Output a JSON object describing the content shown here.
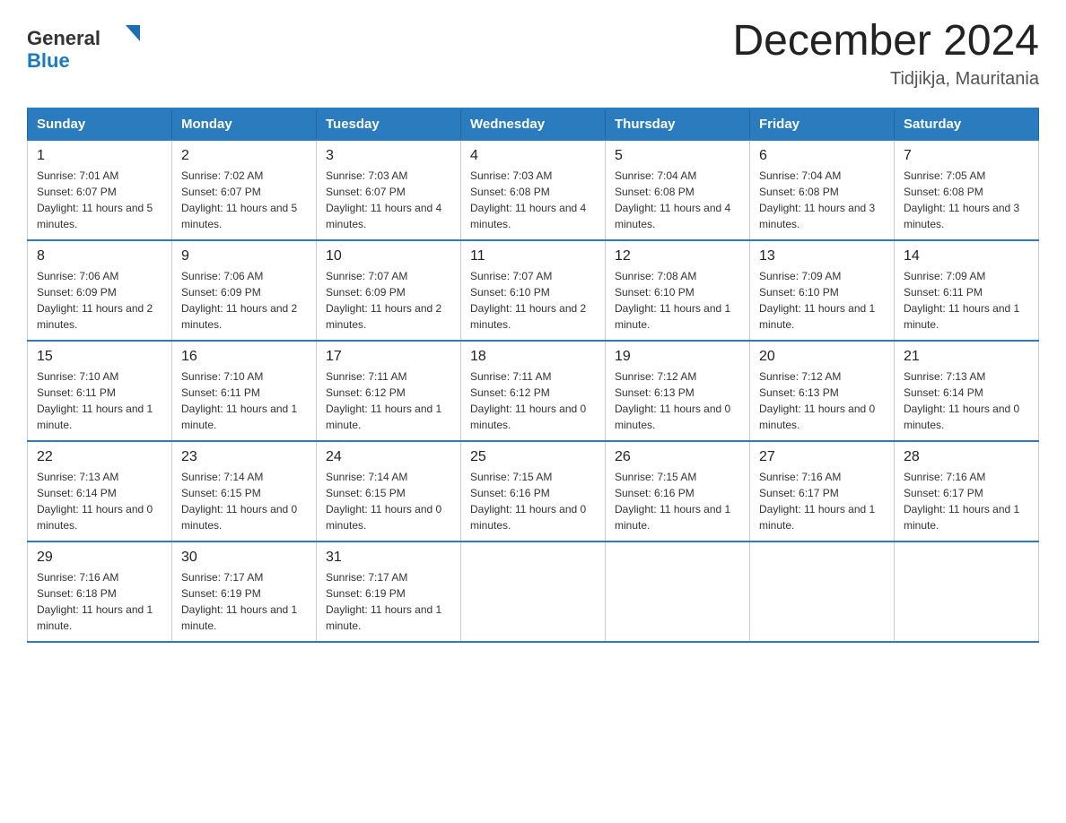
{
  "header": {
    "title": "December 2024",
    "subtitle": "Tidjikja, Mauritania",
    "logo_general": "General",
    "logo_blue": "Blue"
  },
  "calendar": {
    "days_of_week": [
      "Sunday",
      "Monday",
      "Tuesday",
      "Wednesday",
      "Thursday",
      "Friday",
      "Saturday"
    ],
    "weeks": [
      [
        {
          "day": "1",
          "sunrise": "7:01 AM",
          "sunset": "6:07 PM",
          "daylight": "11 hours and 5 minutes."
        },
        {
          "day": "2",
          "sunrise": "7:02 AM",
          "sunset": "6:07 PM",
          "daylight": "11 hours and 5 minutes."
        },
        {
          "day": "3",
          "sunrise": "7:03 AM",
          "sunset": "6:07 PM",
          "daylight": "11 hours and 4 minutes."
        },
        {
          "day": "4",
          "sunrise": "7:03 AM",
          "sunset": "6:08 PM",
          "daylight": "11 hours and 4 minutes."
        },
        {
          "day": "5",
          "sunrise": "7:04 AM",
          "sunset": "6:08 PM",
          "daylight": "11 hours and 4 minutes."
        },
        {
          "day": "6",
          "sunrise": "7:04 AM",
          "sunset": "6:08 PM",
          "daylight": "11 hours and 3 minutes."
        },
        {
          "day": "7",
          "sunrise": "7:05 AM",
          "sunset": "6:08 PM",
          "daylight": "11 hours and 3 minutes."
        }
      ],
      [
        {
          "day": "8",
          "sunrise": "7:06 AM",
          "sunset": "6:09 PM",
          "daylight": "11 hours and 2 minutes."
        },
        {
          "day": "9",
          "sunrise": "7:06 AM",
          "sunset": "6:09 PM",
          "daylight": "11 hours and 2 minutes."
        },
        {
          "day": "10",
          "sunrise": "7:07 AM",
          "sunset": "6:09 PM",
          "daylight": "11 hours and 2 minutes."
        },
        {
          "day": "11",
          "sunrise": "7:07 AM",
          "sunset": "6:10 PM",
          "daylight": "11 hours and 2 minutes."
        },
        {
          "day": "12",
          "sunrise": "7:08 AM",
          "sunset": "6:10 PM",
          "daylight": "11 hours and 1 minute."
        },
        {
          "day": "13",
          "sunrise": "7:09 AM",
          "sunset": "6:10 PM",
          "daylight": "11 hours and 1 minute."
        },
        {
          "day": "14",
          "sunrise": "7:09 AM",
          "sunset": "6:11 PM",
          "daylight": "11 hours and 1 minute."
        }
      ],
      [
        {
          "day": "15",
          "sunrise": "7:10 AM",
          "sunset": "6:11 PM",
          "daylight": "11 hours and 1 minute."
        },
        {
          "day": "16",
          "sunrise": "7:10 AM",
          "sunset": "6:11 PM",
          "daylight": "11 hours and 1 minute."
        },
        {
          "day": "17",
          "sunrise": "7:11 AM",
          "sunset": "6:12 PM",
          "daylight": "11 hours and 1 minute."
        },
        {
          "day": "18",
          "sunrise": "7:11 AM",
          "sunset": "6:12 PM",
          "daylight": "11 hours and 0 minutes."
        },
        {
          "day": "19",
          "sunrise": "7:12 AM",
          "sunset": "6:13 PM",
          "daylight": "11 hours and 0 minutes."
        },
        {
          "day": "20",
          "sunrise": "7:12 AM",
          "sunset": "6:13 PM",
          "daylight": "11 hours and 0 minutes."
        },
        {
          "day": "21",
          "sunrise": "7:13 AM",
          "sunset": "6:14 PM",
          "daylight": "11 hours and 0 minutes."
        }
      ],
      [
        {
          "day": "22",
          "sunrise": "7:13 AM",
          "sunset": "6:14 PM",
          "daylight": "11 hours and 0 minutes."
        },
        {
          "day": "23",
          "sunrise": "7:14 AM",
          "sunset": "6:15 PM",
          "daylight": "11 hours and 0 minutes."
        },
        {
          "day": "24",
          "sunrise": "7:14 AM",
          "sunset": "6:15 PM",
          "daylight": "11 hours and 0 minutes."
        },
        {
          "day": "25",
          "sunrise": "7:15 AM",
          "sunset": "6:16 PM",
          "daylight": "11 hours and 0 minutes."
        },
        {
          "day": "26",
          "sunrise": "7:15 AM",
          "sunset": "6:16 PM",
          "daylight": "11 hours and 1 minute."
        },
        {
          "day": "27",
          "sunrise": "7:16 AM",
          "sunset": "6:17 PM",
          "daylight": "11 hours and 1 minute."
        },
        {
          "day": "28",
          "sunrise": "7:16 AM",
          "sunset": "6:17 PM",
          "daylight": "11 hours and 1 minute."
        }
      ],
      [
        {
          "day": "29",
          "sunrise": "7:16 AM",
          "sunset": "6:18 PM",
          "daylight": "11 hours and 1 minute."
        },
        {
          "day": "30",
          "sunrise": "7:17 AM",
          "sunset": "6:19 PM",
          "daylight": "11 hours and 1 minute."
        },
        {
          "day": "31",
          "sunrise": "7:17 AM",
          "sunset": "6:19 PM",
          "daylight": "11 hours and 1 minute."
        },
        null,
        null,
        null,
        null
      ]
    ]
  }
}
